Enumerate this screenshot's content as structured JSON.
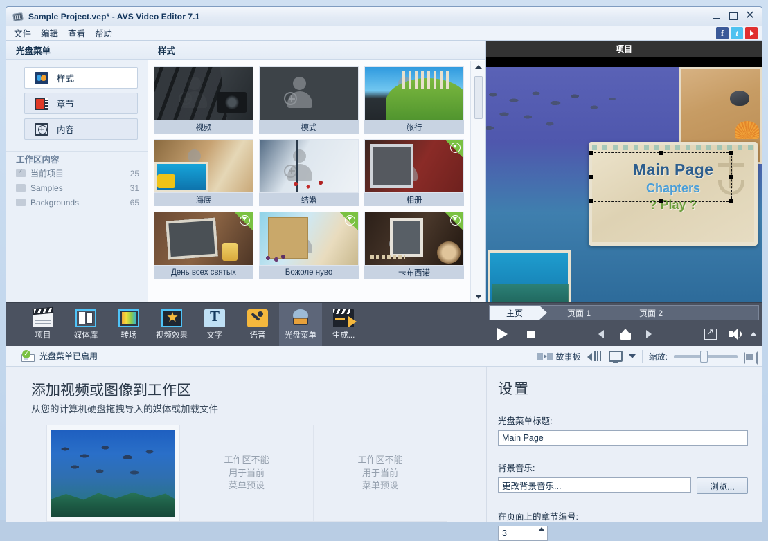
{
  "window": {
    "title": "Sample Project.vep* - AVS Video Editor 7.1",
    "minimize": "–",
    "maximize": "□",
    "close": "✕"
  },
  "menubar": {
    "items": [
      {
        "label": "文件"
      },
      {
        "label": "编辑"
      },
      {
        "label": "查看"
      },
      {
        "label": "帮助"
      }
    ],
    "social": [
      {
        "name": "facebook-icon",
        "glyph": "f"
      },
      {
        "name": "twitter-icon",
        "glyph": "t"
      },
      {
        "name": "youtube-icon",
        "glyph": ""
      }
    ]
  },
  "sidebar": {
    "header": "光盘菜单",
    "buttons": [
      {
        "label": "样式",
        "icon": "style-icon",
        "active": true
      },
      {
        "label": "章节",
        "icon": "chapters-icon",
        "active": false
      },
      {
        "label": "内容",
        "icon": "content-icon",
        "active": false
      }
    ],
    "workspace_header": "工作区内容",
    "rows": [
      {
        "label": "当前项目",
        "count": "25"
      },
      {
        "label": "Samples",
        "count": "31"
      },
      {
        "label": "Backgrounds",
        "count": "65"
      }
    ]
  },
  "styles_panel": {
    "header": "样式",
    "items": [
      {
        "label": "视频",
        "downloadable": false,
        "art": "bg-video"
      },
      {
        "label": "模式",
        "downloadable": false,
        "art": "bg-pattern"
      },
      {
        "label": "旅行",
        "downloadable": false,
        "art": "bg-travel"
      },
      {
        "label": "海底",
        "downloadable": false,
        "art": "bg-sea"
      },
      {
        "label": "结婚",
        "downloadable": false,
        "art": "bg-wed"
      },
      {
        "label": "相册",
        "downloadable": true,
        "art": "bg-album"
      },
      {
        "label": "День всех святых",
        "downloadable": true,
        "art": "bg-hall"
      },
      {
        "label": "Божоле нуво",
        "downloadable": true,
        "art": "bg-beau"
      },
      {
        "label": "卡布西诺",
        "downloadable": true,
        "art": "bg-capp"
      }
    ]
  },
  "preview": {
    "header": "项目",
    "menu_text": {
      "main": "Main Page",
      "chapters": "Chapters",
      "play": "? Play ?"
    }
  },
  "toolbar": {
    "tools": [
      {
        "label": "项目",
        "icon": "project-icon",
        "active": false
      },
      {
        "label": "媒体库",
        "icon": "media-library-icon",
        "active": false
      },
      {
        "label": "转场",
        "icon": "transitions-icon",
        "active": false
      },
      {
        "label": "视频效果",
        "icon": "video-effects-icon",
        "active": false
      },
      {
        "label": "文字",
        "icon": "text-icon",
        "active": false
      },
      {
        "label": "语音",
        "icon": "voice-icon",
        "active": false
      },
      {
        "label": "光盘菜单",
        "icon": "disc-menu-icon",
        "active": true
      },
      {
        "label": "生成...",
        "icon": "produce-icon",
        "active": false
      }
    ]
  },
  "page_tabs": [
    {
      "label": "主页",
      "active": true
    },
    {
      "label": "页面 1",
      "active": false
    },
    {
      "label": "页面 2",
      "active": false
    }
  ],
  "playback": {
    "play": "play-icon",
    "stop": "stop-icon",
    "prev": "previous-icon",
    "home": "home-icon",
    "next": "next-icon",
    "fullscreen": "fullscreen-icon",
    "volume": "volume-icon",
    "volume_caret": "caret-up-icon"
  },
  "status_strip": {
    "enabled_label": "光盘菜单已启用",
    "storyboard_label": "故事板",
    "zoom_label": "缩放:",
    "zoom_value": 42
  },
  "workspace": {
    "title": "添加视频或图像到工作区",
    "subtitle": "从您的计算机硬盘拖拽导入的媒体或加载文件",
    "slots": [
      {
        "type": "image",
        "text": ""
      },
      {
        "type": "empty",
        "text": "工作区不能\n用于当前\n菜单预设"
      },
      {
        "type": "empty",
        "text": "工作区不能\n用于当前\n菜单预设"
      }
    ]
  },
  "settings": {
    "title": "设置",
    "disc_menu_title_label": "光盘菜单标题:",
    "disc_menu_title_value": "Main Page",
    "background_music_label": "背景音乐:",
    "background_music_value": "更改背景音乐...",
    "browse_button": "浏览...",
    "chapters_per_page_label": "在页面上的章节编号:",
    "chapters_per_page_value": "3"
  }
}
